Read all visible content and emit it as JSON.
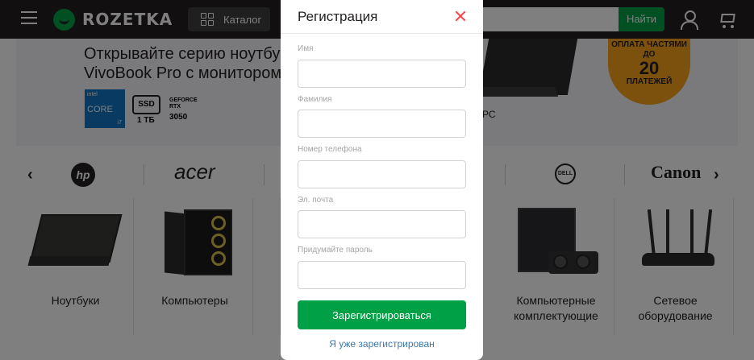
{
  "header": {
    "logo_text": "ROZETKA",
    "catalog_label": "Каталог",
    "search_button_label": "Найти"
  },
  "banner": {
    "line1": "Открывайте серию ноутбук",
    "line2": "VivoBook Pro с монитором",
    "intel_label": "intel",
    "core_label": "CORE",
    "core_gen": "i7",
    "ssd_label": "SSD",
    "ssd_capacity": "1 ТБ",
    "gpu_line": "GEFORCE RTX",
    "gpu_model": "3050",
    "side_text": "РС",
    "promo_top": "ОПЛАТА ЧАСТЯМИ ДО",
    "promo_number": "20",
    "promo_bottom": "ПЛАТЕЖЕЙ"
  },
  "brands": {
    "items": [
      "hp",
      "acer",
      "DELL",
      "Canon"
    ]
  },
  "categories": {
    "items": [
      {
        "label": "Ноутбуки"
      },
      {
        "label": "Компьютеры"
      },
      {
        "label": "Компьютерные комплектующие"
      },
      {
        "label": "Сетевое оборудование"
      }
    ]
  },
  "modal": {
    "title": "Регистрация",
    "fields": [
      {
        "label": "Имя",
        "value": ""
      },
      {
        "label": "Фамилия",
        "value": ""
      },
      {
        "label": "Номер телефона",
        "value": ""
      },
      {
        "label": "Эл. почта",
        "value": ""
      },
      {
        "label": "Придумайте пароль",
        "value": ""
      }
    ],
    "submit_label": "Зарегистрироваться",
    "login_link": "Я уже зарегистрирован"
  },
  "colors": {
    "brand_green": "#00a046",
    "header_dark": "#221f1f",
    "close_red": "#f84147",
    "link_blue": "#3e77aa"
  }
}
